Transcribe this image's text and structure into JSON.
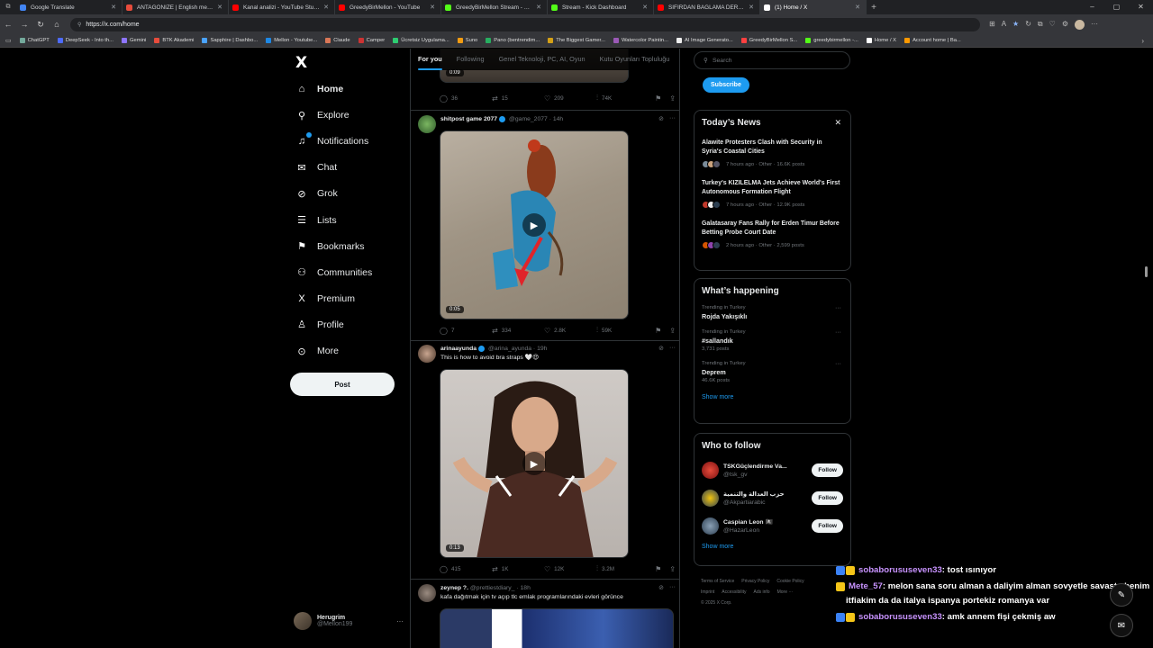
{
  "browser": {
    "tabs": [
      {
        "label": "Google Translate",
        "color": "#4285f4"
      },
      {
        "label": "ANTAGONIZE | English meaning -",
        "color": "#e74c3c"
      },
      {
        "label": "Kanal analizi - YouTube Studio",
        "color": "#ff0000"
      },
      {
        "label": "GreedyBirMellon - YouTube",
        "color": "#ff0000"
      },
      {
        "label": "GreedyBirMellon Stream - Watch",
        "color": "#53fc18"
      },
      {
        "label": "Stream - Kick Dashboard",
        "color": "#53fc18"
      },
      {
        "label": "SIFIRDAN BAĞLAMA DERSİ 3 (EN",
        "color": "#ff0000"
      },
      {
        "label": "(1) Home / X",
        "color": "#ffffff"
      }
    ],
    "url": "https://x.com/home",
    "bookmarks": [
      "ChatGPT",
      "DeepSeek - Into th...",
      "Gemini",
      "BTK Akademi",
      "Sapphire | Dashbo...",
      "Mellon - Youtube...",
      "Claude",
      "Camper",
      "Ücretsiz Uygulama...",
      "Suno",
      "Pano (bentrendim...",
      "The Biggest Gamer...",
      "Watercolor Paintin...",
      "AI Image Generato...",
      "GreedyBirMellon S...",
      "greedybirmellon -...",
      "Home / X",
      "Account home | Ba..."
    ]
  },
  "nav": {
    "logo": "X",
    "items": [
      {
        "label": "Home",
        "icon": "home-icon",
        "glyph": "⌂"
      },
      {
        "label": "Explore",
        "icon": "search-icon",
        "glyph": "⚲"
      },
      {
        "label": "Notifications",
        "icon": "bell-icon",
        "glyph": "♫"
      },
      {
        "label": "Chat",
        "icon": "mail-icon",
        "glyph": "✉"
      },
      {
        "label": "Grok",
        "icon": "grok-icon",
        "glyph": "⊘"
      },
      {
        "label": "Lists",
        "icon": "list-icon",
        "glyph": "☰"
      },
      {
        "label": "Bookmarks",
        "icon": "bookmark-icon",
        "glyph": "⚑"
      },
      {
        "label": "Communities",
        "icon": "communities-icon",
        "glyph": "⚇"
      },
      {
        "label": "Premium",
        "icon": "premium-icon",
        "glyph": "X"
      },
      {
        "label": "Profile",
        "icon": "profile-icon",
        "glyph": "♙"
      },
      {
        "label": "More",
        "icon": "more-icon",
        "glyph": "⊙"
      }
    ],
    "post_label": "Post",
    "user": {
      "name": "Herugrim",
      "handle": "@Mellon199"
    }
  },
  "feed": {
    "tabs": [
      "For you",
      "Following",
      "Genel Teknoloji, PC, AI, Oyun",
      "Kutu Oyunları Topluluğu"
    ],
    "top_stats": {
      "replies": "36",
      "reposts": "15",
      "likes": "209",
      "views": "74K",
      "duration": "0:09"
    },
    "posts": [
      {
        "name": "shitpost game 2077",
        "handle": "@game_2077",
        "time": "14h",
        "text": "",
        "duration": "0:05",
        "replies": "7",
        "reposts": "334",
        "likes": "2.8K",
        "views": "59K"
      },
      {
        "name": "arinaayunda",
        "handle": "@arina_ayunda",
        "time": "19h",
        "text": "This is how to avoid bra straps 🤍😍",
        "duration": "0:13",
        "replies": "415",
        "reposts": "1K",
        "likes": "12K",
        "views": "3.2M"
      },
      {
        "name": "zeynep ?.",
        "handle": "@prettiestdiary_",
        "time": "18h",
        "text": "kafa dağıtmak için tv açıp tlc emlak programlarındaki evleri görünce"
      }
    ]
  },
  "sidebar": {
    "search_placeholder": "Search",
    "subscribe_label": "Subscribe",
    "news_title": "Today’s News",
    "news": [
      {
        "title": "Alawite Protesters Clash with Security in Syria's Coastal Cities",
        "meta": "7 hours ago · Other · 16.6K posts"
      },
      {
        "title": "Turkey's KIZILELMA Jets Achieve World's First Autonomous Formation Flight",
        "meta": "7 hours ago · Other · 12.9K posts"
      },
      {
        "title": "Galatasaray Fans Rally for Erden Timur Before Betting Probe Court Date",
        "meta": "2 hours ago · Other · 2,599 posts"
      }
    ],
    "happening_title": "What’s happening",
    "trends": [
      {
        "context": "Trending in Turkey",
        "name": "Rojda Yakışıklı",
        "posts": ""
      },
      {
        "context": "Trending in Turkey",
        "name": "#sallandık",
        "posts": "3,731 posts"
      },
      {
        "context": "Trending in Turkey",
        "name": "Deprem",
        "posts": "46.6K posts"
      }
    ],
    "show_more": "Show more",
    "wtf_title": "Who to follow",
    "follow_label": "Follow",
    "who_to_follow": [
      {
        "name": "TSKGüçlendirme Va...",
        "handle": "@tsk_gv"
      },
      {
        "name": "حزب العدالة والتنمية",
        "handle": "@Akpartiarabic"
      },
      {
        "name": "Caspian Leon 🏴‍☠️",
        "handle": "@HazarLeon"
      }
    ],
    "footer": [
      "Terms of Service",
      "Privacy Policy",
      "Cookie Policy",
      "Imprint",
      "Accessibility",
      "Ads info",
      "More ···",
      "© 2025 X Corp."
    ]
  },
  "chat_overlay": [
    {
      "user": "sobaborususeven33",
      "msg": ": tost ısınıyor"
    },
    {
      "user": "Mete_57",
      "msg": ": melon sana soru alman a daliyim alman sovyetle savasta benim itfiakim da da italya ispanya portekiz romanya var"
    },
    {
      "user": "sobaborususeven33",
      "msg": ": amk annem fişi çekmiş aw"
    }
  ]
}
